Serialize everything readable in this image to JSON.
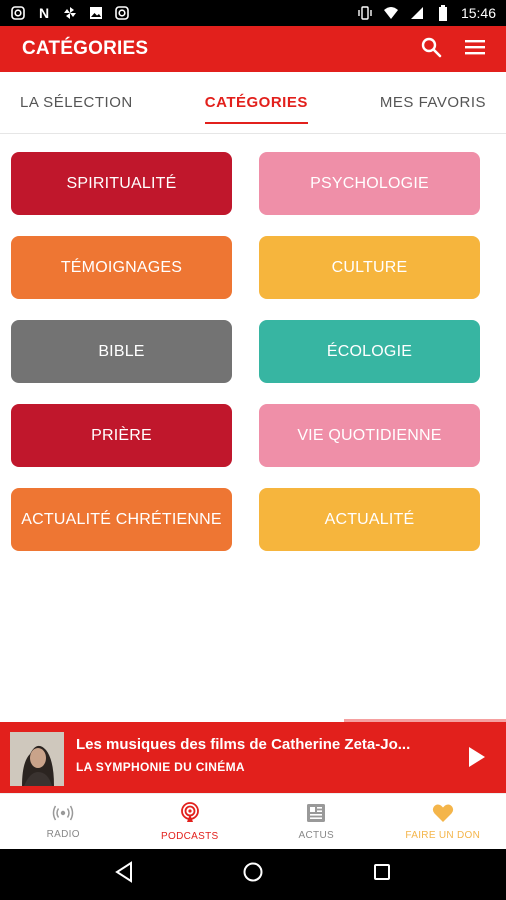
{
  "status": {
    "time": "15:46",
    "left_icons": [
      "instagram-icon",
      "n-icon",
      "pinwheel-icon",
      "image-icon",
      "instagram-icon"
    ],
    "right_icons": [
      "vibrate-icon",
      "wifi-icon",
      "signal-icon",
      "battery-icon"
    ]
  },
  "appbar": {
    "title": "CATÉGORIES",
    "icons": [
      "search-icon",
      "menu-icon"
    ]
  },
  "tabs": [
    {
      "label": "LA SÉLECTION",
      "active": false
    },
    {
      "label": "CATÉGORIES",
      "active": true
    },
    {
      "label": "MES FAVORIS",
      "active": false
    }
  ],
  "categories": [
    {
      "label": "SPIRITUALITÉ",
      "color": "#c0172c"
    },
    {
      "label": "PSYCHOLOGIE",
      "color": "#ef8fa8"
    },
    {
      "label": "TÉMOIGNAGES",
      "color": "#ee7633"
    },
    {
      "label": "CULTURE",
      "color": "#f6b53d"
    },
    {
      "label": "BIBLE",
      "color": "#737373"
    },
    {
      "label": "ÉCOLOGIE",
      "color": "#37b5a2"
    },
    {
      "label": "PRIÈRE",
      "color": "#c0172c"
    },
    {
      "label": "VIE QUOTIDIENNE",
      "color": "#ef8fa8"
    },
    {
      "label": "ACTUALITÉ CHRÉTIENNE",
      "color": "#ee7633"
    },
    {
      "label": "ACTUALITÉ",
      "color": "#f6b53d"
    }
  ],
  "player": {
    "title": "Les musiques des films de Catherine Zeta-Jo...",
    "subtitle": "LA SYMPHONIE DU CINÉMA",
    "progress": 0.68
  },
  "bottom_nav": [
    {
      "label": "RADIO",
      "icon": "radio-icon",
      "state": "normal"
    },
    {
      "label": "PODCASTS",
      "icon": "podcast-icon",
      "state": "active"
    },
    {
      "label": "ACTUS",
      "icon": "news-icon",
      "state": "normal"
    },
    {
      "label": "FAIRE UN DON",
      "icon": "heart-icon",
      "state": "don"
    }
  ],
  "colors": {
    "accent": "#e2201c"
  }
}
